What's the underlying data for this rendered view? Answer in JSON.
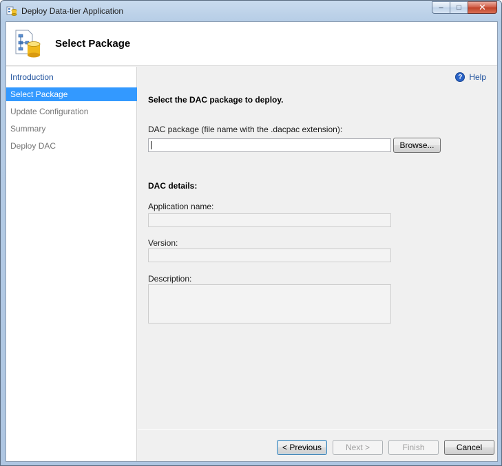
{
  "window": {
    "title": "Deploy Data-tier Application",
    "controls": {
      "minimize": "–",
      "maximize": "□",
      "close": "✕"
    }
  },
  "banner": {
    "title": "Select Package",
    "icon": "package-database-icon"
  },
  "sidebar": {
    "items": [
      {
        "label": "Introduction",
        "state": "link"
      },
      {
        "label": "Select Package",
        "state": "active"
      },
      {
        "label": "Update Configuration",
        "state": "disabled"
      },
      {
        "label": "Summary",
        "state": "disabled"
      },
      {
        "label": "Deploy DAC",
        "state": "disabled"
      }
    ]
  },
  "main": {
    "help_label": "Help",
    "heading": "Select the DAC package to deploy.",
    "package_label": "DAC package (file name with the .dacpac extension):",
    "package_value": "",
    "browse_label": "Browse...",
    "details_heading": "DAC details:",
    "app_name_label": "Application name:",
    "version_label": "Version:",
    "description_label": "Description:"
  },
  "footer": {
    "previous": "< Previous",
    "next": "Next >",
    "finish": "Finish",
    "cancel": "Cancel"
  },
  "colors": {
    "selection": "#3399ff",
    "link": "#1c4f9c",
    "panel": "#f0f0f0"
  }
}
